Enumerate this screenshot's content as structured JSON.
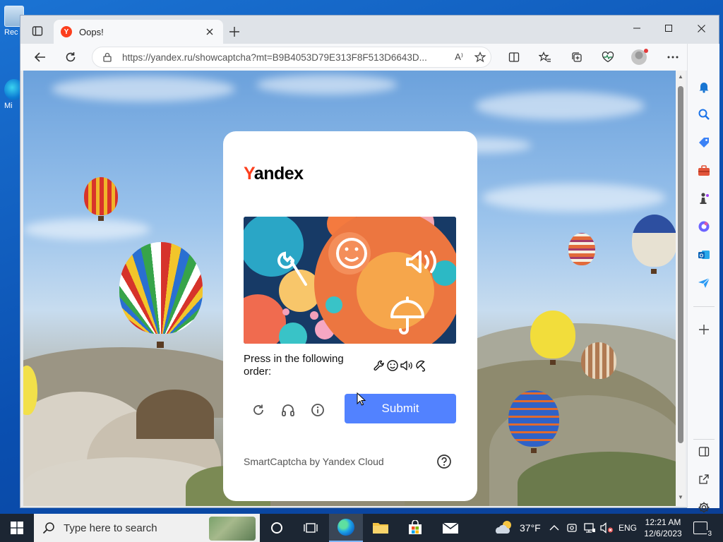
{
  "desktop": {
    "icons": [
      {
        "label": "Rec",
        "kind": "recycle-bin"
      },
      {
        "label": "Mi",
        "kind": "edge"
      }
    ]
  },
  "browser": {
    "tab": {
      "title": "Oops!",
      "favicon": "Y"
    },
    "address": {
      "url": "https://yandex.ru/showcaptcha?mt=B9B4053D79E313F8F513D6643D..."
    },
    "read_aloud_label": "A⁾"
  },
  "captcha": {
    "logo_first": "Y",
    "logo_rest": "andex",
    "prompt": "Press in the following order:",
    "order_icons": [
      "wrench-icon",
      "smiley-icon",
      "speaker-icon",
      "umbrella-icon"
    ],
    "submit_label": "Submit",
    "footer": "SmartCaptcha by Yandex Cloud",
    "accent_color": "#5282ff"
  },
  "taskbar": {
    "search_placeholder": "Type here to search",
    "weather": "37°F",
    "language": "ENG",
    "time": "12:21 AM",
    "date": "12/6/2023",
    "notifications": "3"
  }
}
